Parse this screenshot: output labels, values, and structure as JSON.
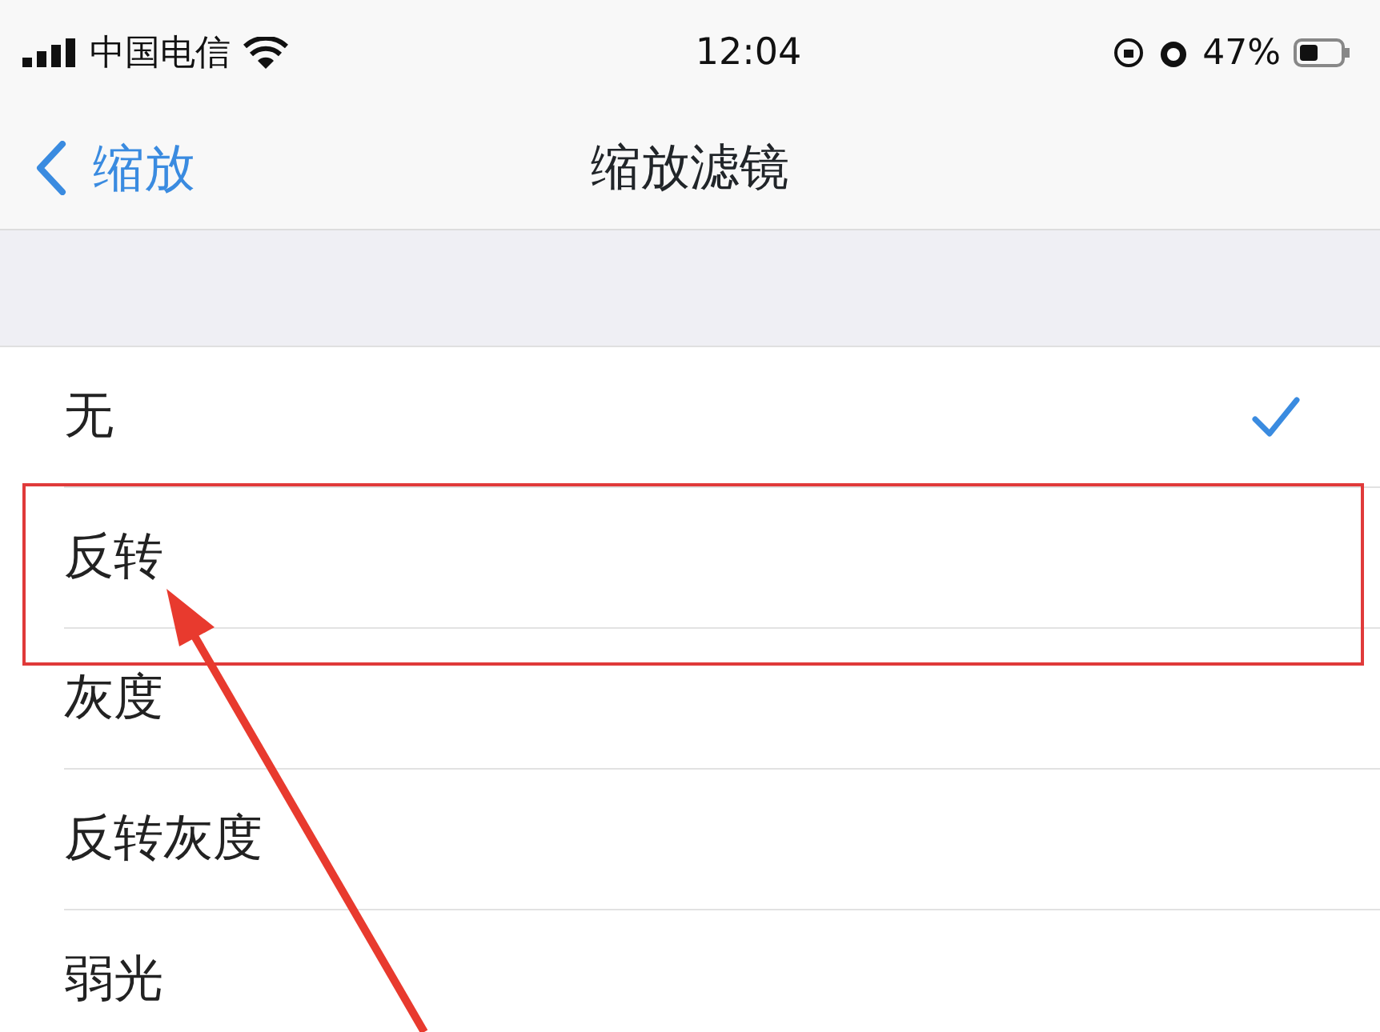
{
  "status_bar": {
    "carrier": "中国电信",
    "time": "12:04",
    "battery_percent": "47%"
  },
  "nav": {
    "back": "缩放",
    "title": "缩放滤镜"
  },
  "options": [
    {
      "label": "无",
      "selected": true
    },
    {
      "label": "反转",
      "selected": false
    },
    {
      "label": "灰度",
      "selected": false
    },
    {
      "label": "反转灰度",
      "selected": false
    },
    {
      "label": "弱光",
      "selected": false
    }
  ]
}
